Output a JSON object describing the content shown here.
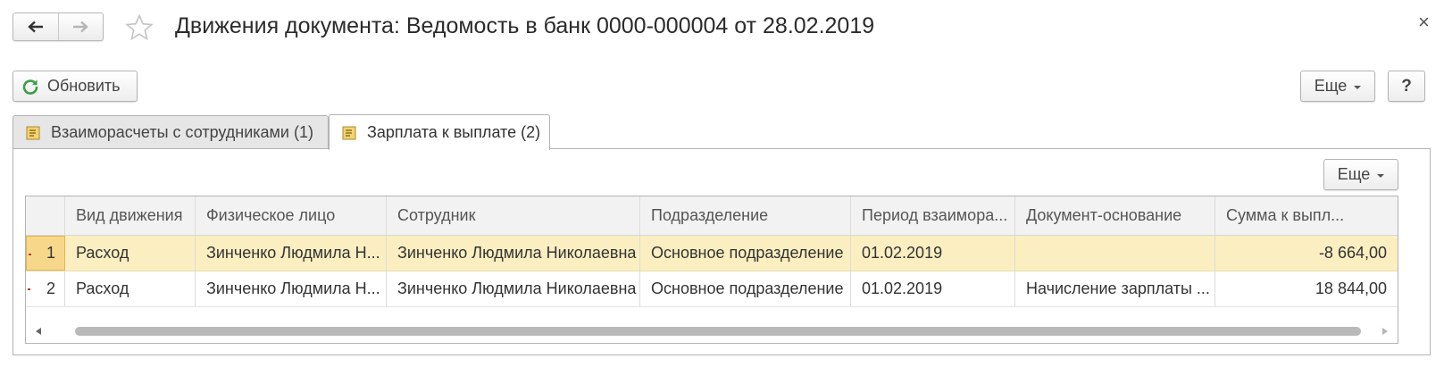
{
  "window": {
    "title": "Движения документа: Ведомость в банк 0000-000004 от 28.02.2019",
    "close_glyph": "×"
  },
  "icons": {
    "back": "arrow-left-icon",
    "forward": "arrow-right-icon",
    "favorite": "star-icon",
    "refresh": "refresh-icon",
    "register": "register-icon"
  },
  "toolbar": {
    "refresh_label": "Обновить",
    "more_label": "Еще",
    "help_label": "?"
  },
  "tabs": [
    {
      "label": "Взаиморасчеты с сотрудниками (1)",
      "active": false
    },
    {
      "label": "Зарплата к выплате (2)",
      "active": true
    }
  ],
  "panel": {
    "more_label": "Еще"
  },
  "table": {
    "columns": [
      "",
      "Вид движения",
      "Физическое лицо",
      "Сотрудник",
      "Подразделение",
      "Период взаимора...",
      "Документ-основание",
      "Сумма к выпл..."
    ],
    "rows": [
      {
        "n": "1",
        "kind": "Расход",
        "person": "Зинченко Людмила Н...",
        "employee": "Зинченко Людмила Николаевна",
        "department": "Основное подразделение",
        "period": "01.02.2019",
        "basis": "",
        "amount": "-8 664,00",
        "selected": true
      },
      {
        "n": "2",
        "kind": "Расход",
        "person": "Зинченко Людмила Н...",
        "employee": "Зинченко Людмила Николаевна",
        "department": "Основное подразделение",
        "period": "01.02.2019",
        "basis": "Начисление зарплаты ...",
        "amount": "18 844,00",
        "selected": false
      }
    ]
  },
  "colors": {
    "selected_row": "#fbeec0",
    "selected_cell": "#f7d88b",
    "refresh_icon": "#3aa047",
    "row_marker": "#c0392b"
  }
}
